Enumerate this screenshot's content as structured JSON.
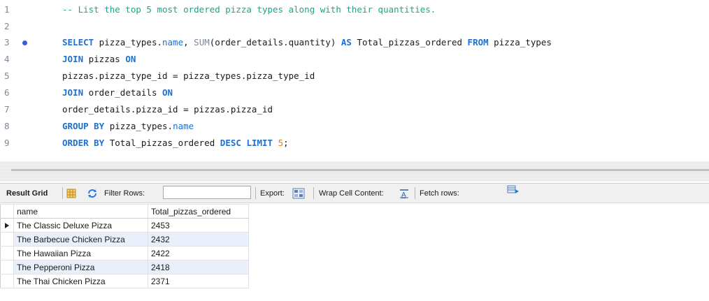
{
  "editor": {
    "lines": [
      {
        "n": "1",
        "parts": [
          [
            "cmt",
            "-- List the top 5 most ordered pizza types along with their quantities."
          ]
        ]
      },
      {
        "n": "2",
        "parts": []
      },
      {
        "n": "3",
        "dot": true,
        "parts": [
          [
            "kw",
            "SELECT"
          ],
          [
            "plain",
            " pizza_types."
          ],
          [
            "fld",
            "name"
          ],
          [
            "plain",
            ", "
          ],
          [
            "fn",
            "SUM"
          ],
          [
            "plain",
            "(order_details.quantity) "
          ],
          [
            "kw",
            "AS"
          ],
          [
            "plain",
            " Total_pizzas_ordered "
          ],
          [
            "kw",
            "FROM"
          ],
          [
            "plain",
            " pizza_types"
          ]
        ]
      },
      {
        "n": "4",
        "parts": [
          [
            "kw",
            "JOIN"
          ],
          [
            "plain",
            " pizzas "
          ],
          [
            "kw",
            "ON"
          ]
        ]
      },
      {
        "n": "5",
        "parts": [
          [
            "plain",
            "pizzas.pizza_type_id = pizza_types.pizza_type_id"
          ]
        ]
      },
      {
        "n": "6",
        "parts": [
          [
            "kw",
            "JOIN"
          ],
          [
            "plain",
            " order_details "
          ],
          [
            "kw",
            "ON"
          ]
        ]
      },
      {
        "n": "7",
        "parts": [
          [
            "plain",
            "order_details.pizza_id = pizzas.pizza_id"
          ]
        ]
      },
      {
        "n": "8",
        "parts": [
          [
            "kw",
            "GROUP BY"
          ],
          [
            "plain",
            " pizza_types."
          ],
          [
            "fld",
            "name"
          ]
        ]
      },
      {
        "n": "9",
        "parts": [
          [
            "kw",
            "ORDER BY"
          ],
          [
            "plain",
            " Total_pizzas_ordered "
          ],
          [
            "kw",
            "DESC"
          ],
          [
            "plain",
            " "
          ],
          [
            "kw",
            "LIMIT"
          ],
          [
            "plain",
            " "
          ],
          [
            "num-lit",
            "5"
          ],
          [
            "plain",
            ";"
          ]
        ]
      }
    ]
  },
  "toolbar": {
    "result_grid": "Result Grid",
    "filter_rows": "Filter Rows:",
    "filter_value": "",
    "export": "Export:",
    "wrap": "Wrap Cell Content:",
    "fetch": "Fetch rows:"
  },
  "grid": {
    "columns": [
      "name",
      "Total_pizzas_ordered"
    ],
    "rows": [
      [
        "The Classic Deluxe Pizza",
        "2453"
      ],
      [
        "The Barbecue Chicken Pizza",
        "2432"
      ],
      [
        "The Hawaiian Pizza",
        "2422"
      ],
      [
        "The Pepperoni Pizza",
        "2418"
      ],
      [
        "The Thai Chicken Pizza",
        "2371"
      ]
    ]
  },
  "colors": {
    "keyword": "#1f6fd0",
    "comment": "#1aa58a",
    "number": "#e08a00",
    "row_alt": "#e9f0fb"
  }
}
